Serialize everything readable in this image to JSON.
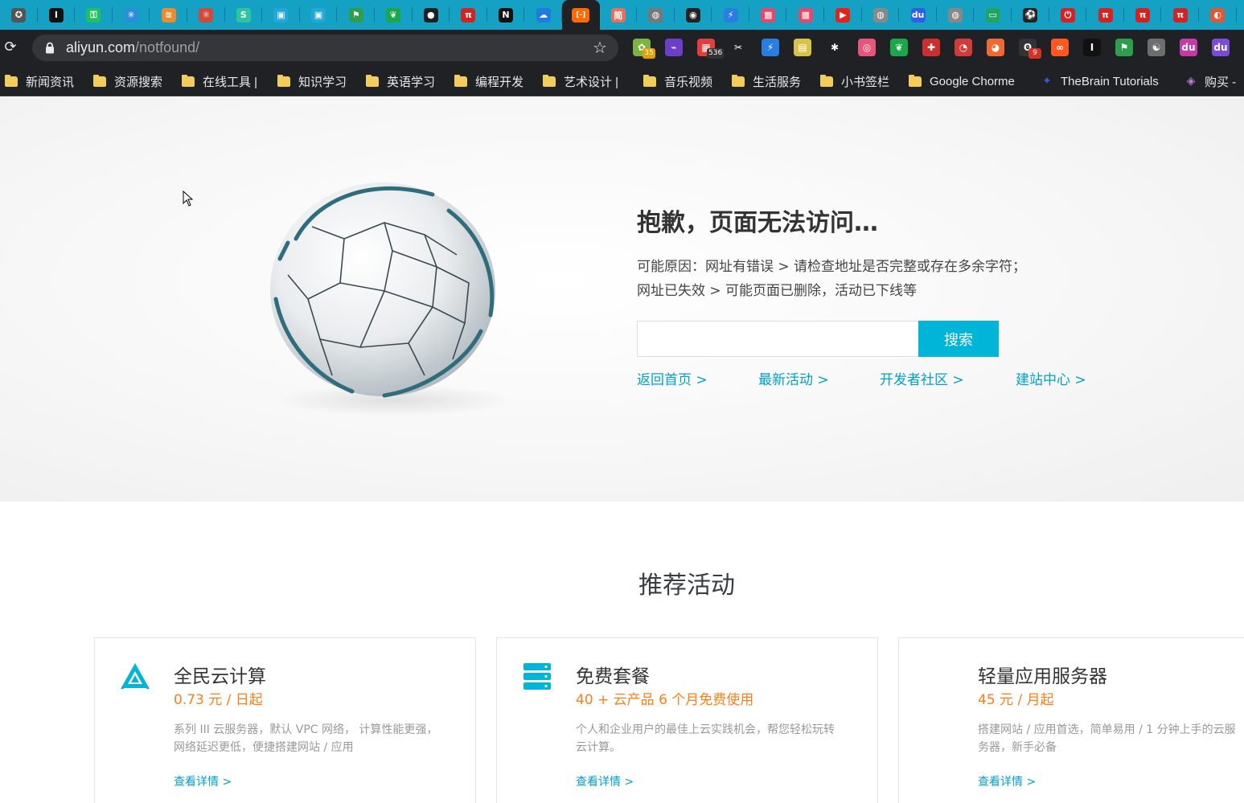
{
  "browser": {
    "tabs": [
      {
        "icon": "person-icon",
        "glyph": "✪",
        "color": "#555555"
      },
      {
        "icon": "instapaper-icon",
        "glyph": "I",
        "color": "#111111"
      },
      {
        "icon": "key-green-icon",
        "glyph": "⚿",
        "color": "#20c060"
      },
      {
        "icon": "network-icon",
        "glyph": "✳",
        "color": "#2a8fd8"
      },
      {
        "icon": "orange-stripes-icon",
        "glyph": "≋",
        "color": "#f08a2e"
      },
      {
        "icon": "molecule-icon",
        "glyph": "⚛",
        "color": "#d04a3a"
      },
      {
        "icon": "s-circle-icon",
        "glyph": "S",
        "color": "#2ec4a0"
      },
      {
        "icon": "calendar-icon",
        "glyph": "▣",
        "color": "#22a8d8"
      },
      {
        "icon": "calendar-icon",
        "glyph": "▣",
        "color": "#22a8d8"
      },
      {
        "icon": "green-flag-icon",
        "glyph": "⚑",
        "color": "#2e9e4e"
      },
      {
        "icon": "evernote-icon",
        "glyph": "❦",
        "color": "#1aa84a"
      },
      {
        "icon": "github-icon",
        "glyph": "●",
        "color": "#1b1f23"
      },
      {
        "icon": "pi-icon",
        "glyph": "π",
        "color": "#d32222"
      },
      {
        "icon": "notion-icon",
        "glyph": "N",
        "color": "#111111"
      },
      {
        "icon": "cloud-icon",
        "glyph": "☁",
        "color": "#1e7ce0"
      },
      {
        "icon": "aliyun-icon",
        "glyph": "[-]",
        "color": "#ff6a00",
        "active": true
      },
      {
        "icon": "jianshu-icon",
        "glyph": "简",
        "color": "#ea6f5a"
      },
      {
        "icon": "globe-icon",
        "glyph": "◍",
        "color": "#777777"
      },
      {
        "icon": "robot-eye-icon",
        "glyph": "◉",
        "color": "#222222"
      },
      {
        "icon": "bolt-icon",
        "glyph": "⚡",
        "color": "#2a7de1"
      },
      {
        "icon": "bilibili-icon",
        "glyph": "▩",
        "color": "#e7476b"
      },
      {
        "icon": "bilibili-icon",
        "glyph": "▩",
        "color": "#e7476b"
      },
      {
        "icon": "youtube-icon",
        "glyph": "▶",
        "color": "#e62117"
      },
      {
        "icon": "globe-icon",
        "glyph": "◍",
        "color": "#888888"
      },
      {
        "icon": "baidu-icon",
        "glyph": "du",
        "color": "#2f5fe8"
      },
      {
        "icon": "globe-icon",
        "glyph": "◍",
        "color": "#888888"
      },
      {
        "icon": "screen-icon",
        "glyph": "▭",
        "color": "#1fa463"
      },
      {
        "icon": "ball-icon",
        "glyph": "⚽",
        "color": "#222222"
      },
      {
        "icon": "power-icon",
        "glyph": "⏻",
        "color": "#d32222"
      },
      {
        "icon": "pi-icon",
        "glyph": "π",
        "color": "#d32222"
      },
      {
        "icon": "pi-icon",
        "glyph": "π",
        "color": "#d32222"
      },
      {
        "icon": "pi-icon",
        "glyph": "π",
        "color": "#d32222"
      },
      {
        "icon": "duckduckgo-icon",
        "glyph": "◐",
        "color": "#de5833"
      }
    ],
    "url_host": "aliyun.com",
    "url_path": "/notfound/",
    "extensions": [
      {
        "icon": "frog-extension-icon",
        "glyph": "✿",
        "color": "#7cb342",
        "badge": "35",
        "badge_color": "#e6a100"
      },
      {
        "icon": "purple-square-icon",
        "glyph": "⌁",
        "color": "#6c3fc8"
      },
      {
        "icon": "calendar-extension-icon",
        "glyph": "▦",
        "color": "#e33e3e",
        "badge": "536",
        "badge_color": "#333333"
      },
      {
        "icon": "scissors-icon",
        "glyph": "✂",
        "color": "#202124"
      },
      {
        "icon": "bolt-extension-icon",
        "glyph": "⚡",
        "color": "#2a7de1"
      },
      {
        "icon": "picture-icon",
        "glyph": "▤",
        "color": "#d9c24a"
      },
      {
        "icon": "pin-icon",
        "glyph": "✱",
        "color": "#202124"
      },
      {
        "icon": "pink-circle-icon",
        "glyph": "◎",
        "color": "#e9557a"
      },
      {
        "icon": "evernote-extension-icon",
        "glyph": "❦",
        "color": "#1aa84a"
      },
      {
        "icon": "red-cross-icon",
        "glyph": "✚",
        "color": "#cc2f2f"
      },
      {
        "icon": "color-wheel-icon",
        "glyph": "◔",
        "color": "#d23b3b"
      },
      {
        "icon": "orange-blob-icon",
        "glyph": "◕",
        "color": "#ef6a32"
      },
      {
        "icon": "glasses-icon",
        "glyph": "ʘ",
        "color": "#333333",
        "badge": "9",
        "badge_color": "#d93025"
      },
      {
        "icon": "infinity-icon",
        "glyph": "∞",
        "color": "#ff5722"
      },
      {
        "icon": "instapaper-extension-icon",
        "glyph": "I",
        "color": "#111111"
      },
      {
        "icon": "green-flag-extension-icon",
        "glyph": "⚑",
        "color": "#2e9e4e"
      },
      {
        "icon": "owl-icon",
        "glyph": "☯",
        "color": "#6e6e6e"
      },
      {
        "icon": "bilibili-extension-icon",
        "glyph": "du",
        "color": "#c53aa8"
      },
      {
        "icon": "baidu-extension-icon",
        "glyph": "du",
        "color": "#7a4cd8"
      }
    ],
    "bookmarks": [
      {
        "label": "新闻资讯",
        "type": "folder"
      },
      {
        "label": "资源搜索",
        "type": "folder"
      },
      {
        "label": "在线工具 |",
        "type": "folder"
      },
      {
        "label": "知识学习",
        "type": "folder"
      },
      {
        "label": "英语学习",
        "type": "folder"
      },
      {
        "label": "编程开发",
        "type": "folder"
      },
      {
        "label": "艺术设计 |",
        "type": "folder"
      },
      {
        "label": "音乐视频",
        "type": "folder"
      },
      {
        "label": "生活服务",
        "type": "folder"
      },
      {
        "label": "小书签栏",
        "type": "folder"
      },
      {
        "label": "Google Chorme",
        "type": "folder"
      },
      {
        "label": "TheBrain Tutorials",
        "type": "thebrain-icon"
      },
      {
        "label": "购买 -",
        "type": "gem-icon"
      }
    ]
  },
  "error": {
    "title": "抱歉，页面无法访问…",
    "reason_line1": "可能原因：网址有错误 > 请检查地址是否完整或存在多余字符；",
    "reason_line2": "网址已失效 > 可能页面已删除，活动已下线等",
    "search_placeholder": "",
    "search_button": "搜索",
    "links": [
      "返回首页 >",
      "最新活动 >",
      "开发者社区 >",
      "建站中心 >"
    ]
  },
  "recommend": {
    "title": "推荐活动",
    "cards": [
      {
        "icon": "cloud-triangle-icon",
        "title": "全民云计算",
        "price": "0.73 元 / 日起",
        "desc": "系列 III 云服务器，默认 VPC 网络， 计算性能更强，网络延迟更低，便捷搭建网站 / 应用",
        "link": "查看详情 >"
      },
      {
        "icon": "server-stack-icon",
        "title": "免费套餐",
        "price": "40 + 云产品 6 个月免费使用",
        "desc": "个人和企业用户的最佳上云实践机会，帮您轻松玩转云计算。",
        "link": "查看详情 >"
      },
      {
        "icon": "lightweight-server-icon",
        "title": "轻量应用服务器",
        "price": "45 元 / 月起",
        "desc": "搭建网站 / 应用首选，简单易用 / 1 分钟上手的云服务器，新手必备",
        "link": "查看详情 >"
      }
    ]
  },
  "colors": {
    "tab_strip": "#14a1c3",
    "chrome_dark": "#202124",
    "accent": "#00b5d8",
    "link": "#00a2ca",
    "price": "#ff7e17"
  }
}
